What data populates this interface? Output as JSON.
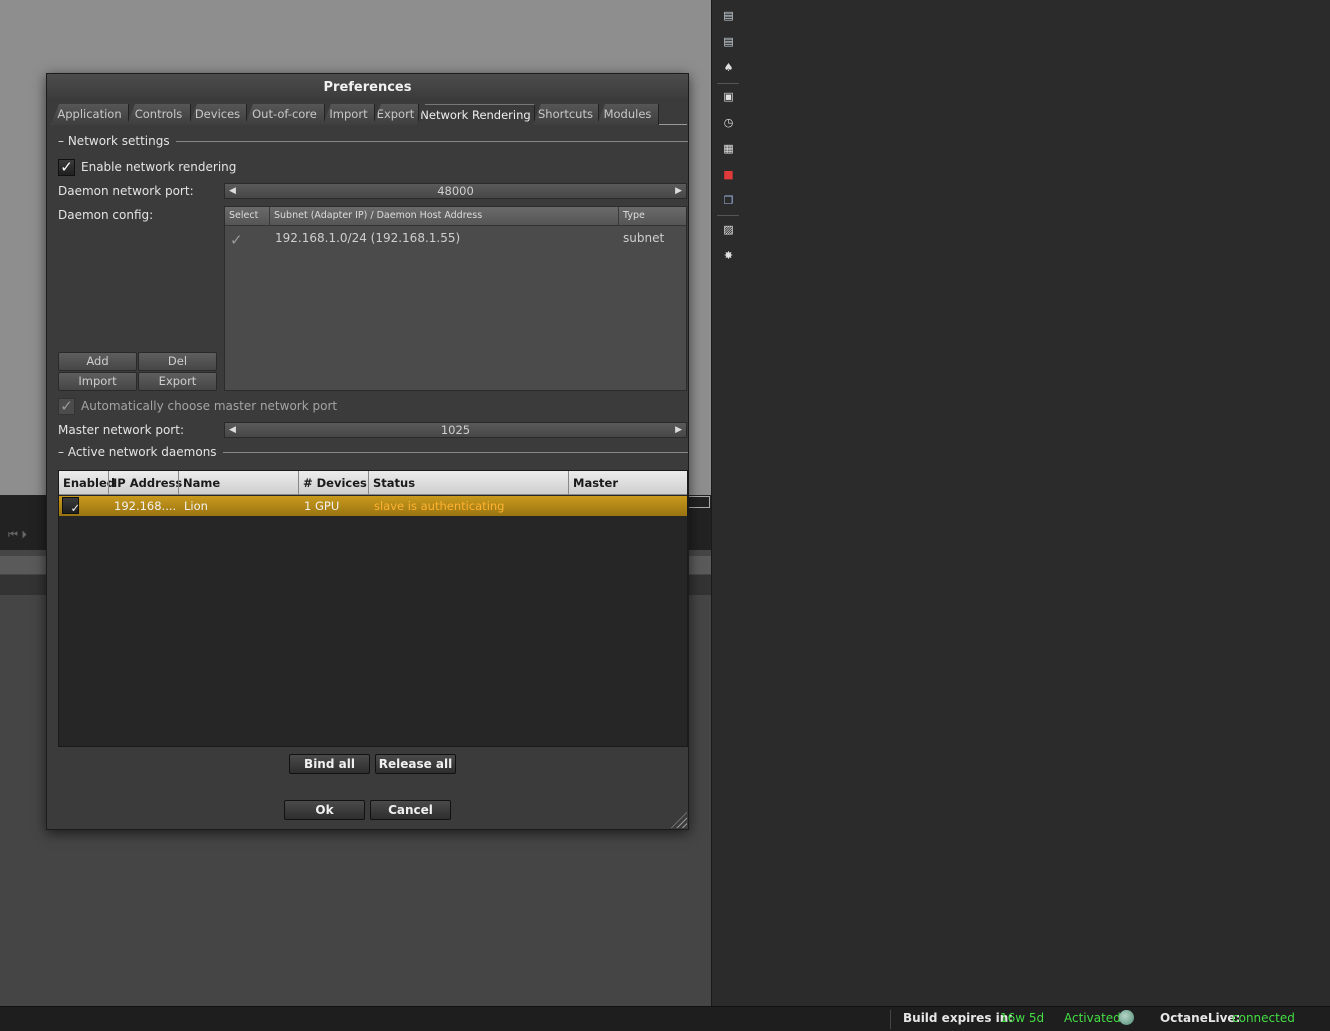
{
  "sidebar_icons": [
    {
      "name": "database-icon",
      "glyph": "▤",
      "color": "#cfd8e0"
    },
    {
      "name": "database-stack-icon",
      "glyph": "▤",
      "color": "#cfd8e0"
    },
    {
      "name": "paint-drop-icon",
      "glyph": "♠",
      "color": "#e0e0e0"
    },
    {
      "name": "film-frame-icon",
      "glyph": "▣",
      "color": "#e0e0e0"
    },
    {
      "name": "clock-icon",
      "glyph": "◷",
      "color": "#e0e0e0"
    },
    {
      "name": "node-graph-icon",
      "glyph": "▦",
      "color": "#e0e0e0"
    },
    {
      "name": "red-cube-icon",
      "glyph": "■",
      "color": "#e03a3a"
    },
    {
      "name": "layers-icon",
      "glyph": "❐",
      "color": "#9fb8e6"
    },
    {
      "name": "image-icon",
      "glyph": "▨",
      "color": "#e0e0e0"
    },
    {
      "name": "light-burst-icon",
      "glyph": "✸",
      "color": "#e0e0e0"
    }
  ],
  "status_bar": {
    "build_label": "Build expires in:",
    "build_value": "16w 5d",
    "activated": "Activated",
    "live_label": "OctaneLive:",
    "live_value": "connected",
    "accent_green": "#44dd44"
  },
  "dialog": {
    "title": "Preferences",
    "tabs": [
      "Application",
      "Controls",
      "Devices",
      "Out-of-core",
      "Import",
      "Export",
      "Network Rendering",
      "Shortcuts",
      "Modules"
    ],
    "active_tab": "Network Rendering",
    "network_settings": {
      "section": "Network settings",
      "enable_label": "Enable network rendering",
      "enable_checked": true,
      "daemon_port_label": "Daemon network port:",
      "daemon_port_value": "48000",
      "daemon_config_label": "Daemon config:",
      "config_columns": [
        "Select",
        "Subnet (Adapter IP) / Daemon Host Address",
        "Type"
      ],
      "config_rows": [
        {
          "selected": true,
          "address": "192.168.1.0/24 (192.168.1.55)",
          "type": "subnet"
        }
      ],
      "add_label": "Add",
      "del_label": "Del",
      "import_label": "Import",
      "export_label": "Export",
      "auto_master_label": "Automatically choose master network port",
      "auto_master_checked": true,
      "master_port_label": "Master network port:",
      "master_port_value": "1025"
    },
    "active_daemons": {
      "section": "Active network daemons",
      "columns": [
        "Enabled",
        "IP Address",
        "Name",
        "# Devices",
        "Status",
        "Master"
      ],
      "rows": [
        {
          "enabled": true,
          "ip": "192.168....",
          "name": "Lion",
          "devices": "1 GPU",
          "status": "slave is authenticating",
          "master": ""
        }
      ],
      "bind_all": "Bind all",
      "release_all": "Release all"
    },
    "ok": "Ok",
    "cancel": "Cancel"
  }
}
